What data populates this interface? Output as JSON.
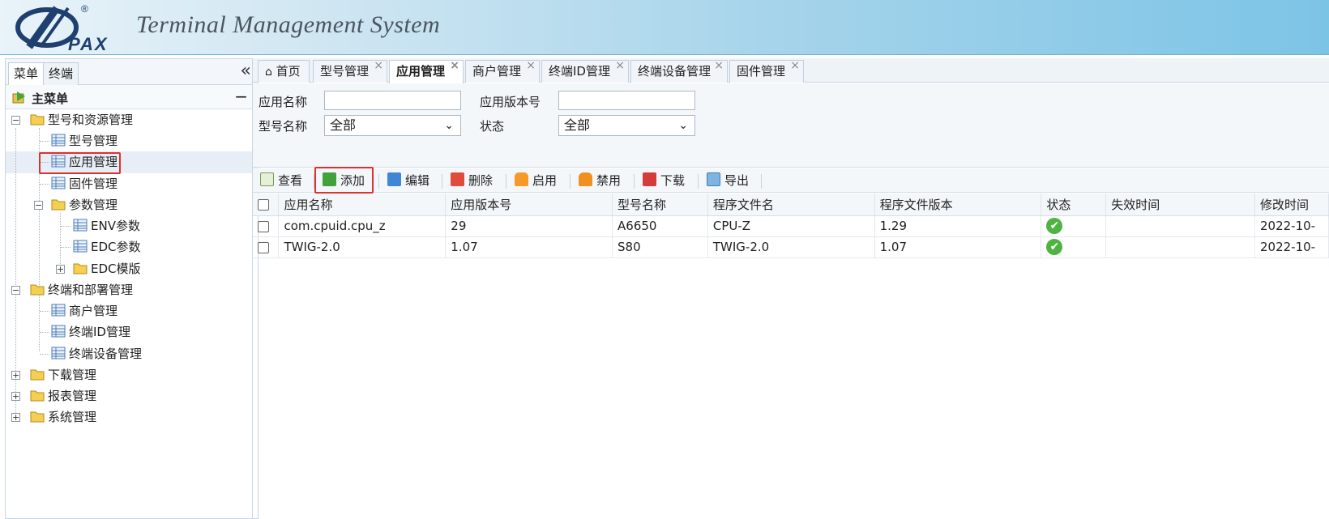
{
  "header": {
    "brand": "PAX",
    "registered": "®",
    "title": "Terminal Management System"
  },
  "sidebar": {
    "tabs": [
      "菜单",
      "终端"
    ],
    "collapse_icon": "«",
    "main_menu": "主菜单",
    "collapse_symbol": "−",
    "tree": [
      {
        "label": "型号和资源管理",
        "type": "folder",
        "expander": "−"
      },
      {
        "label": "型号管理",
        "type": "page"
      },
      {
        "label": "应用管理",
        "type": "page",
        "selected": true
      },
      {
        "label": "固件管理",
        "type": "page"
      },
      {
        "label": "参数管理",
        "type": "folder",
        "expander": "−"
      },
      {
        "label": "ENV参数",
        "type": "page"
      },
      {
        "label": "EDC参数",
        "type": "page"
      },
      {
        "label": "EDC模版",
        "type": "folder",
        "expander": "+"
      },
      {
        "label": "终端和部署管理",
        "type": "folder",
        "expander": "−"
      },
      {
        "label": "商户管理",
        "type": "page"
      },
      {
        "label": "终端ID管理",
        "type": "page"
      },
      {
        "label": "终端设备管理",
        "type": "page"
      },
      {
        "label": "下载管理",
        "type": "folder",
        "expander": "+"
      },
      {
        "label": "报表管理",
        "type": "folder",
        "expander": "+"
      },
      {
        "label": "系统管理",
        "type": "folder",
        "expander": "+"
      }
    ]
  },
  "tabs": [
    {
      "label": "首页",
      "closable": false
    },
    {
      "label": "型号管理",
      "closable": true
    },
    {
      "label": "应用管理",
      "closable": true,
      "active": true
    },
    {
      "label": "商户管理",
      "closable": true
    },
    {
      "label": "终端ID管理",
      "closable": true
    },
    {
      "label": "终端设备管理",
      "closable": true
    },
    {
      "label": "固件管理",
      "closable": true
    }
  ],
  "tab_close": "×",
  "filters": {
    "app_name_label": "应用名称",
    "app_name_value": "",
    "app_version_label": "应用版本号",
    "app_version_value": "",
    "model_label": "型号名称",
    "model_value": "全部",
    "status_label": "状态",
    "status_value": "全部",
    "chevron": "⌄"
  },
  "toolbar": {
    "view": "查看",
    "add": "添加",
    "edit": "编辑",
    "delete": "删除",
    "enable": "启用",
    "disable": "禁用",
    "download": "下载",
    "export": "导出"
  },
  "table": {
    "columns": [
      "应用名称",
      "应用版本号",
      "型号名称",
      "程序文件名",
      "程序文件版本",
      "状态",
      "失效时间",
      "修改时间"
    ],
    "rows": [
      {
        "name": "com.cpuid.cpu_z",
        "version": "29",
        "model": "A6650",
        "file": "CPU-Z",
        "file_version": "1.29",
        "status": "✔",
        "expire": "",
        "modified": "2022-10-"
      },
      {
        "name": "TWIG-2.0",
        "version": "1.07",
        "model": "S80",
        "file": "TWIG-2.0",
        "file_version": "1.07",
        "status": "✔",
        "expire": "",
        "modified": "2022-10-"
      }
    ]
  },
  "colors": {
    "accent": "#7cc4e6",
    "highlight": "#e03030",
    "status_ok": "#4fb342"
  }
}
